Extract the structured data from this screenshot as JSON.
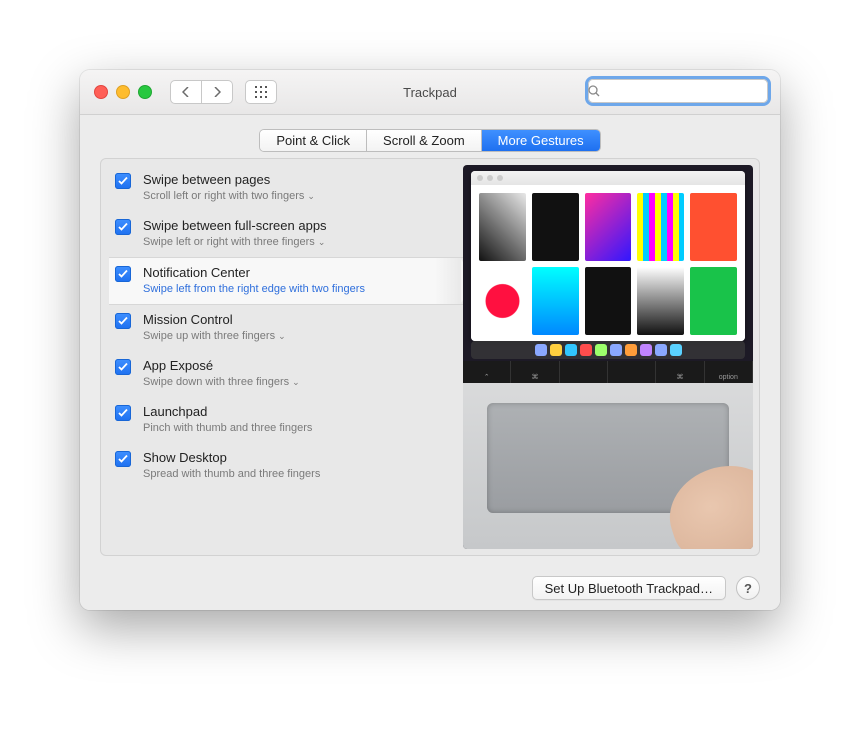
{
  "window": {
    "title": "Trackpad"
  },
  "search": {
    "value": "",
    "placeholder": ""
  },
  "tabs": [
    {
      "label": "Point & Click",
      "active": false
    },
    {
      "label": "Scroll & Zoom",
      "active": false
    },
    {
      "label": "More Gestures",
      "active": true
    }
  ],
  "options": [
    {
      "title": "Swipe between pages",
      "desc": "Scroll left or right with two fingers",
      "checked": true,
      "dropdown": true,
      "selected": false
    },
    {
      "title": "Swipe between full-screen apps",
      "desc": "Swipe left or right with three fingers",
      "checked": true,
      "dropdown": true,
      "selected": false
    },
    {
      "title": "Notification Center",
      "desc": "Swipe left from the right edge with two fingers",
      "checked": true,
      "dropdown": false,
      "selected": true
    },
    {
      "title": "Mission Control",
      "desc": "Swipe up with three fingers",
      "checked": true,
      "dropdown": true,
      "selected": false
    },
    {
      "title": "App Exposé",
      "desc": "Swipe down with three fingers",
      "checked": true,
      "dropdown": true,
      "selected": false
    },
    {
      "title": "Launchpad",
      "desc": "Pinch with thumb and three fingers",
      "checked": true,
      "dropdown": false,
      "selected": false
    },
    {
      "title": "Show Desktop",
      "desc": "Spread with thumb and three fingers",
      "checked": true,
      "dropdown": false,
      "selected": false
    }
  ],
  "footer": {
    "bluetooth_button": "Set Up Bluetooth Trackpad…",
    "help": "?"
  },
  "icons": {
    "back": "chevron-left-icon",
    "fwd": "chevron-right-icon",
    "grid": "grid-icon",
    "search": "search-icon",
    "clear": "clear-icon"
  },
  "preview": {
    "key_labels": [
      "⌃",
      "⌘",
      "",
      "",
      "⌘",
      "option"
    ]
  }
}
